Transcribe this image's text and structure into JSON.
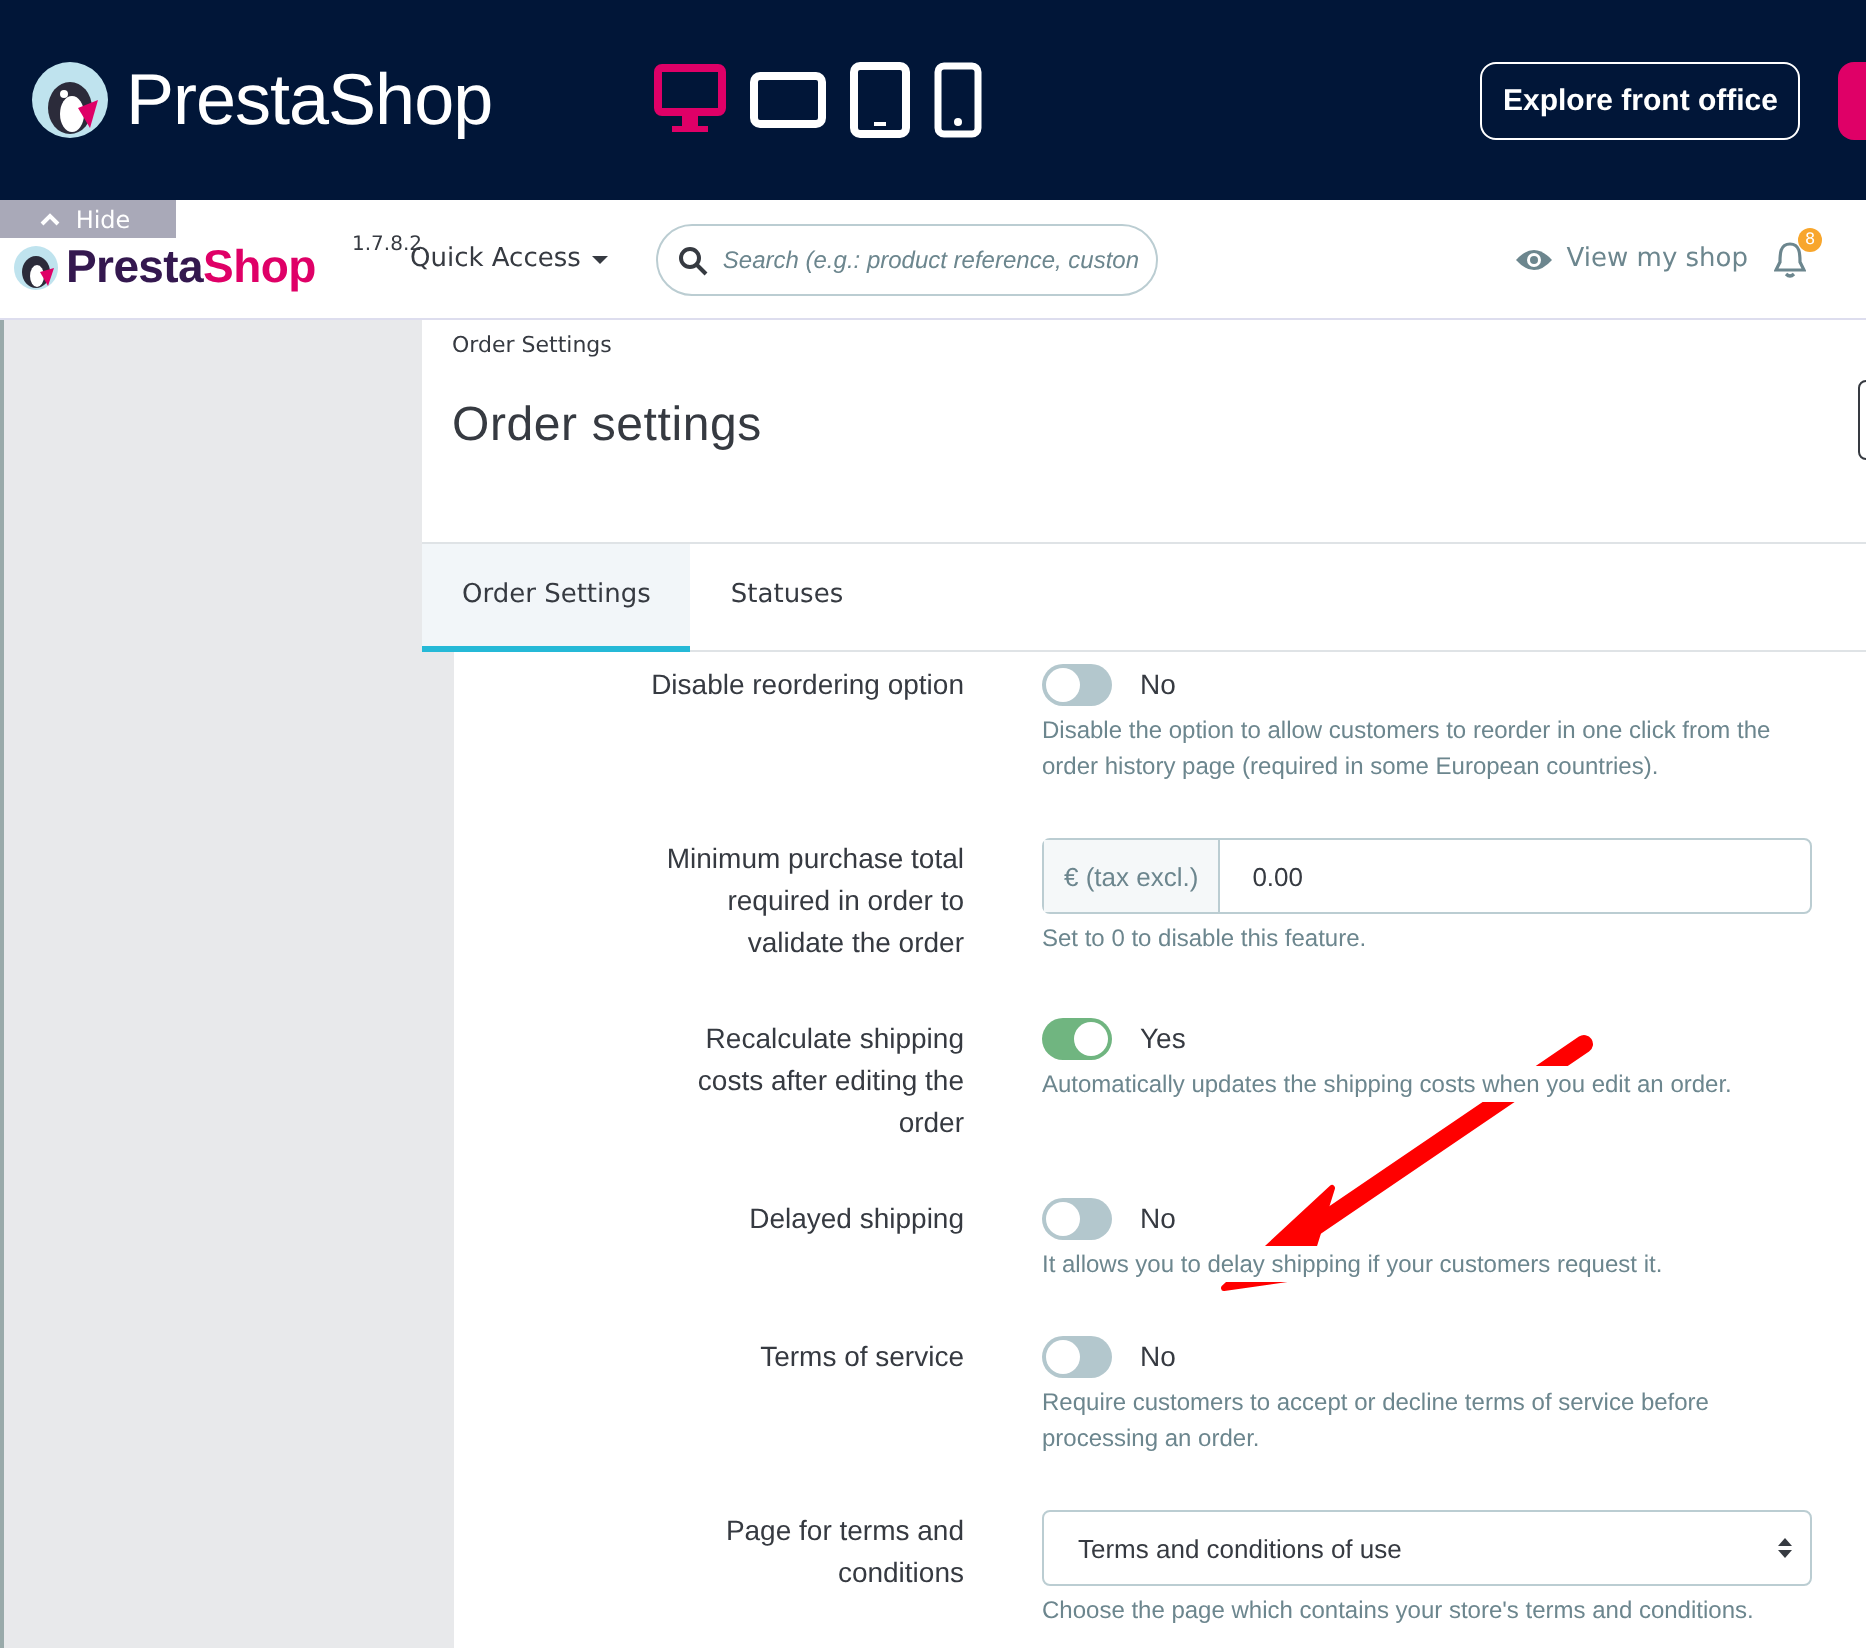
{
  "preview_bar": {
    "logo": "PrestaShop",
    "devices": [
      {
        "kind": "desktop",
        "selected": true
      },
      {
        "kind": "tablet-landscape",
        "selected": false
      },
      {
        "kind": "tablet",
        "selected": false
      },
      {
        "kind": "phone",
        "selected": false
      }
    ],
    "explore_button": "Explore front office"
  },
  "header": {
    "hide_label": "Hide",
    "logo": {
      "start": "Presta",
      "end": "Shop"
    },
    "version": "1.7.8.2",
    "quick_access": "Quick Access",
    "search": {
      "placeholder": "Search (e.g.: product reference, custon"
    },
    "view_shop": "View my shop",
    "notification_count": "8"
  },
  "breadcrumb": "Order Settings",
  "title": "Order settings",
  "tabs": [
    {
      "label": "Order Settings",
      "selected": true
    },
    {
      "label": "Statuses",
      "selected": false
    }
  ],
  "fields": [
    {
      "kind": "switch",
      "label": "Disable reordering option",
      "on": false,
      "state_text": "No",
      "help": "Disable the option to allow customers to reorder in one click from the order history page (required in some European countries)."
    },
    {
      "kind": "input",
      "label": "Minimum purchase total required in order to validate the order",
      "addon": "€ (tax excl.)",
      "value": "0.00",
      "help": "Set to 0 to disable this feature."
    },
    {
      "kind": "switch",
      "label": "Recalculate shipping costs after editing the order",
      "on": true,
      "state_text": "Yes",
      "help": "Automatically updates the shipping costs when you edit an order."
    },
    {
      "kind": "switch",
      "label": "Delayed shipping",
      "on": false,
      "state_text": "No",
      "help": "It allows you to delay shipping if your customers request it."
    },
    {
      "kind": "switch",
      "label": "Terms of service",
      "on": false,
      "state_text": "No",
      "help": "Require customers to accept or decline terms of service before processing an order."
    },
    {
      "kind": "select",
      "label": "Page for terms and conditions",
      "value": "Terms and conditions of use",
      "help": "Choose the page which contains your store's terms and conditions."
    }
  ]
}
